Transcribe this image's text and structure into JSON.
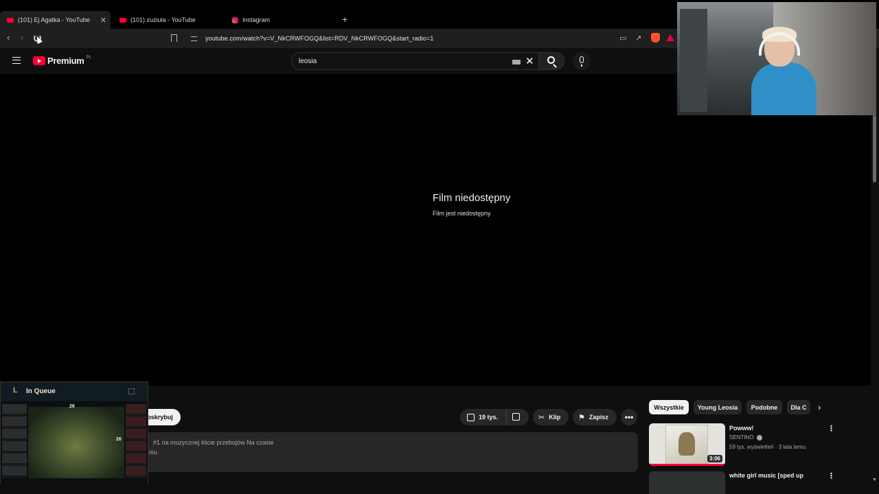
{
  "browser": {
    "tabs": [
      {
        "title": "(101) Ej Agatka - YouTube",
        "active": true,
        "favicon": "youtube-icon"
      },
      {
        "title": "(101) zuziula - YouTube",
        "active": false,
        "favicon": "youtube-icon"
      },
      {
        "title": "Instagram",
        "active": false,
        "favicon": "instagram-icon"
      }
    ],
    "url": "youtube.com/watch?v=V_NkCRWFOGQ&list=RDV_NkCRWFOGQ&start_radio=1",
    "close_glyph": "✕",
    "newtab_glyph": "+"
  },
  "header": {
    "logo_text": "Premium",
    "country_code": "PL",
    "search_value": "leosia"
  },
  "player": {
    "error_title": "Film niedostępny",
    "error_subtitle": "Film jest niedostępny"
  },
  "actions": {
    "subscribe_label": "bskrybuj",
    "likes": "19 tys.",
    "clip_label": "Klip",
    "save_label": "Zapisz",
    "more_glyph": "•••"
  },
  "description": {
    "line1": "#1 na muzycznej liście przebojów Na czasie",
    "line2": "isu."
  },
  "chips": [
    {
      "label": "Wszystkie",
      "selected": true
    },
    {
      "label": "Young Leosia",
      "selected": false
    },
    {
      "label": "Podobne",
      "selected": false
    },
    {
      "label": "Dla C",
      "selected": false
    }
  ],
  "recommendations": [
    {
      "title": "Powww!",
      "channel": "SENTINO",
      "meta": "59 tys. wyświetleń · 3 lata temu",
      "duration": "3:06"
    },
    {
      "title": "white girl music [sped up",
      "channel": "",
      "meta": "",
      "duration": ""
    }
  ],
  "league_overlay": {
    "logo": "L",
    "title": "In Queue",
    "score_left": "26",
    "score_right": "26"
  },
  "colors": {
    "accent": "#ff0033",
    "background": "#0f0f0f",
    "chip_bg": "#272727"
  }
}
